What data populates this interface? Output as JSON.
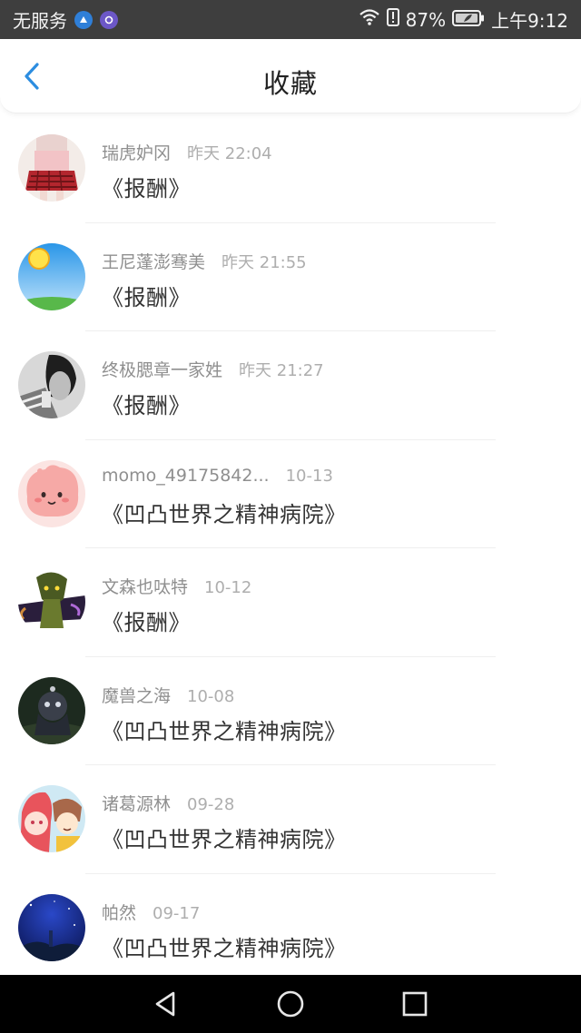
{
  "status_bar": {
    "carrier": "无服务",
    "battery": "87%",
    "time": "上午9:12"
  },
  "header": {
    "title": "收藏",
    "back_icon": "chevron-left-icon",
    "accent": "#2c8de0"
  },
  "favorites": [
    {
      "name": "瑞虎妒冈",
      "time": "昨天 22:04",
      "title": "《报酬》",
      "avatar": "avatar-girl-red-skirt"
    },
    {
      "name": "王尼蓬澎骞美",
      "time": "昨天 21:55",
      "title": "《报酬》",
      "avatar": "avatar-sun-sky"
    },
    {
      "name": "终极腮章一家姓",
      "time": "昨天 21:27",
      "title": "《报酬》",
      "avatar": "avatar-bw-portrait"
    },
    {
      "name": "momo_49175842...",
      "time": "10-13",
      "title": "《凹凸世界之精神病院》",
      "avatar": "avatar-pink-blob"
    },
    {
      "name": "文森也呔特",
      "time": "10-12",
      "title": "《报酬》",
      "avatar": "avatar-game-character"
    },
    {
      "name": "魔兽之海",
      "time": "10-08",
      "title": "《凹凸世界之精神病院》",
      "avatar": "avatar-dark-anime"
    },
    {
      "name": "诸葛源林",
      "time": "09-28",
      "title": "《凹凸世界之精神病院》",
      "avatar": "avatar-anime-duo"
    },
    {
      "name": "帕然",
      "time": "09-17",
      "title": "《凹凸世界之精神病院》",
      "avatar": "avatar-night-sky"
    }
  ],
  "nav_bar": {
    "back_icon": "triangle-back-icon",
    "home_icon": "circle-home-icon",
    "recents_icon": "square-recents-icon"
  }
}
